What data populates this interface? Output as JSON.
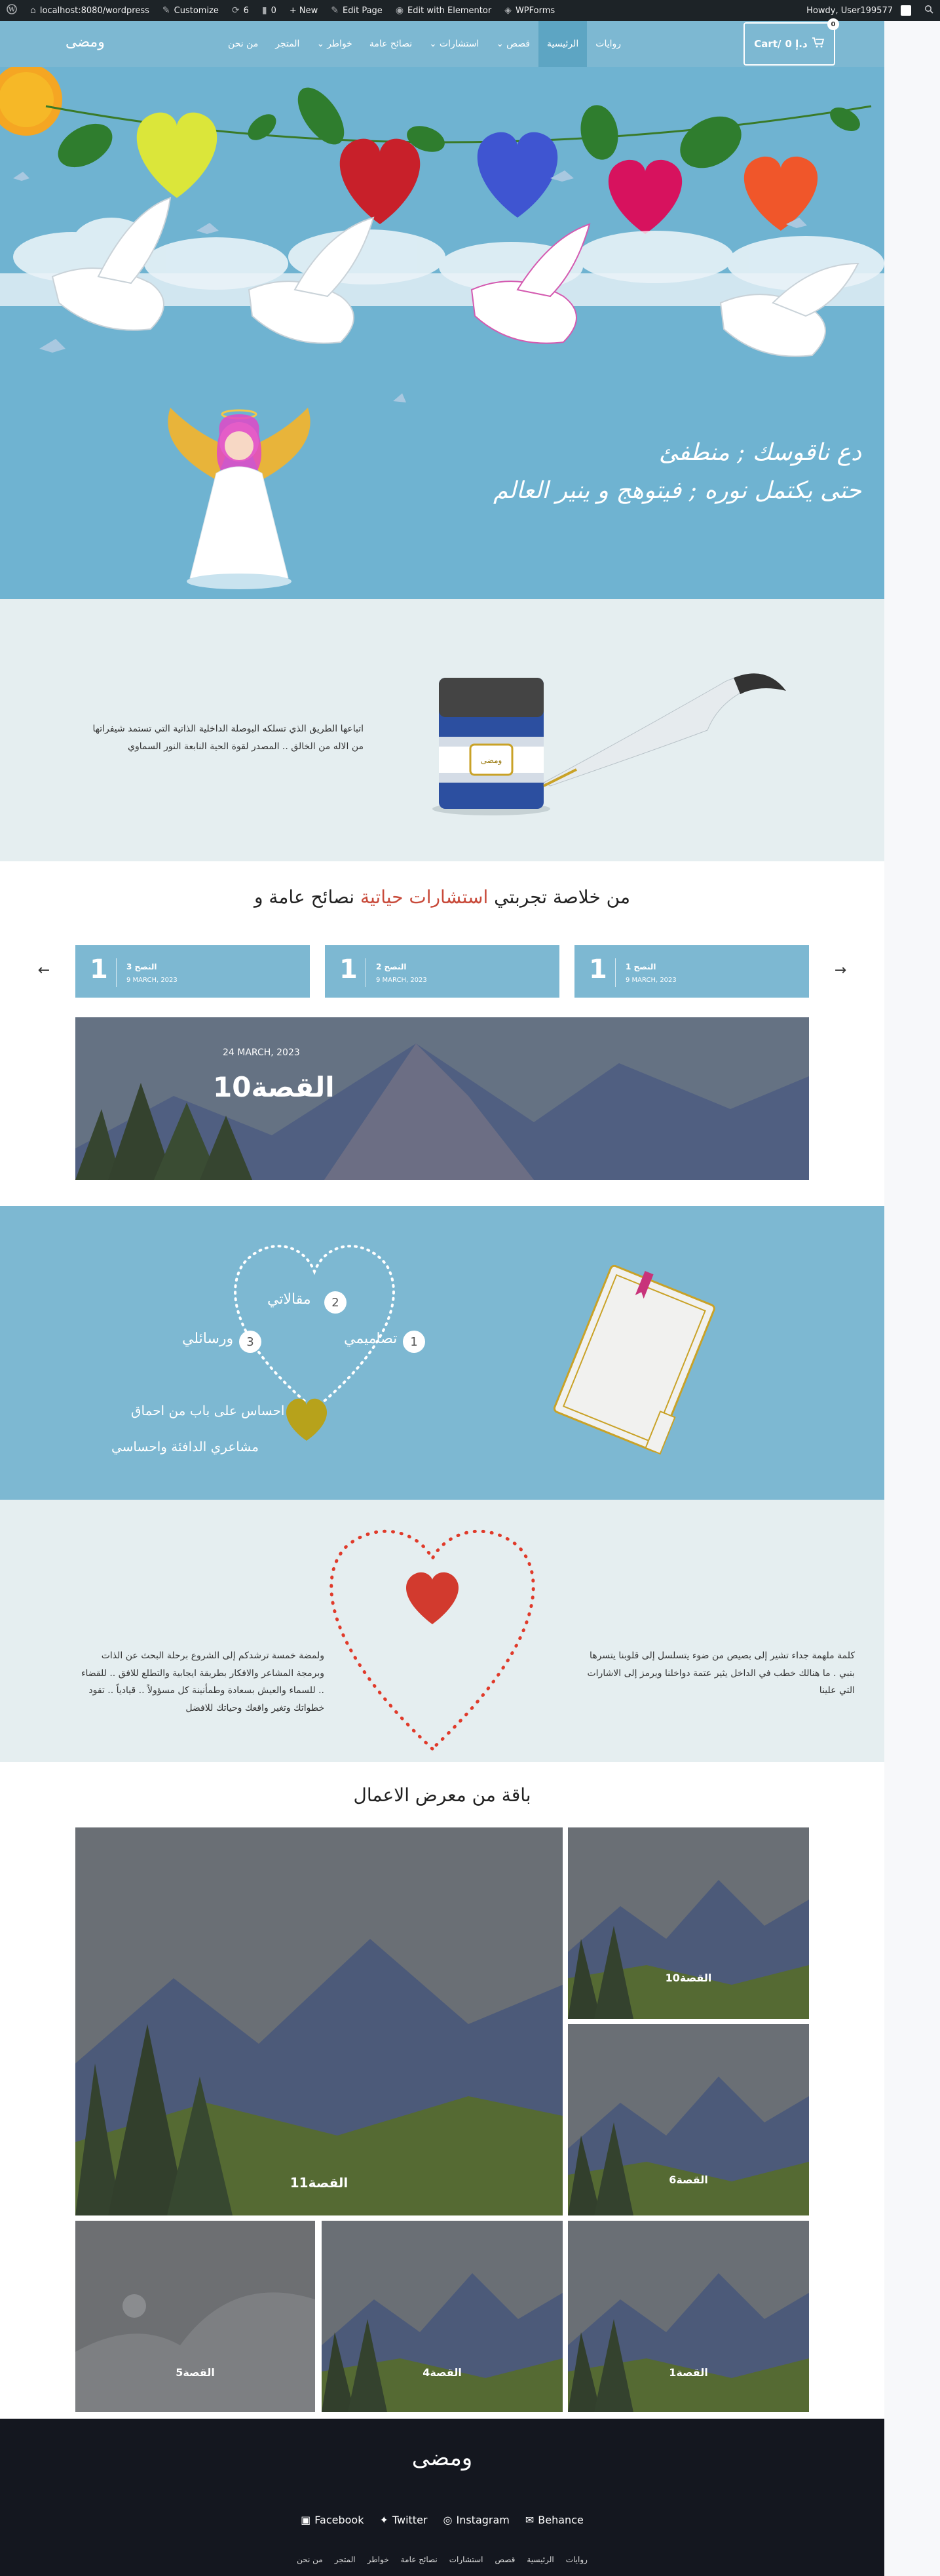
{
  "adminbar": {
    "wp_icon": "wordpress-icon",
    "site_url": "localhost:8080/wordpress",
    "customize": "Customize",
    "updates": "6",
    "comments": "0",
    "new": "+ New",
    "edit_page": "Edit Page",
    "edit_elementor": "Edit with Elementor",
    "wpforms": "WPForms",
    "howdy": "Howdy, User199577"
  },
  "header": {
    "logo": "ومضى",
    "nav": [
      "روايات",
      "الرئيسية",
      "قصص",
      "استشارات",
      "نصائح عامة",
      "خواطر",
      "المتجر",
      "من نحن"
    ],
    "cart_label": "Cart/",
    "cart_amount": "0 د.إ",
    "cart_count": "0"
  },
  "hero": {
    "line1": "دع ناقوسك ; منطفئ",
    "line2": "حتى يكتمل نوره ; فيتوهج و ينير العالم"
  },
  "intro": {
    "text": "اتباعها الطريق الذي تسلكه البوصلة الداخلية الذاتية التي تستمد شيفراتها من الاله من الخالق .. المصدر لقوة الحية النابعة النور السماوي",
    "bottle_label": "ومضى"
  },
  "advice": {
    "title_part1": "نصائح عامة و",
    "title_accent": "استشارات حياتية",
    "title_part2": "من خلاصة تجربتي",
    "cards": [
      {
        "num": "1",
        "title": "النصح 3",
        "date": "9 MARCH, 2023"
      },
      {
        "num": "1",
        "title": "النصح 2",
        "date": "9 MARCH, 2023"
      },
      {
        "num": "1",
        "title": "النصح 1",
        "date": "9 MARCH, 2023"
      }
    ],
    "featured_date": "24 MARCH, 2023",
    "featured_title": "القصة10"
  },
  "hearts": {
    "item1": "مقالاتي",
    "item2": "تصاميمي",
    "item3": "ورسائلي",
    "n1": "2",
    "n2": "1",
    "n3": "3",
    "line1": "احساس على باب من احماق",
    "line2": "مشاعري الدافئة واحساسي"
  },
  "quote": {
    "right": "كلمة ملهمة جداء تشير إلى بصيص من ضوء يتسلسل إلى قلوبنا يتسرها بنبي . ما هنالك خطب في الداخل يثير عتمة دواخلنا ويرمز إلى الاشارات التي علينا",
    "left": "ولمضة خمسة ترشدكم إلى الشروع برحلة البحث عن الذات وبرمجة المشاعر والافكار بطريقة ايجابية والتطلع للافق .. للقضاء .. للسماء والعيش بسعادة وطمأنينة كل مسؤولاً .. قيادياً .. تقود خطواتك وتغير واقعك وحياتك للافضل"
  },
  "gallery": {
    "title": "باقة من معرض الاعمال",
    "items": [
      "القصة11",
      "القصة10",
      "القصة6",
      "القصة5",
      "القصة4",
      "القصة1"
    ]
  },
  "footer": {
    "logo": "ومضى",
    "social": [
      "Facebook",
      "Twitter",
      "Instagram",
      "Behance"
    ],
    "nav": [
      "روايات",
      "الرئيسية",
      "قصص",
      "استشارات",
      "نصائح عامة",
      "خواطر",
      "المتجر",
      "من نحن"
    ]
  },
  "colors": {
    "primary": "#7db8d2",
    "light_bg": "#e5eef0",
    "footer": "#14171f",
    "accent": "#c84a3a"
  }
}
